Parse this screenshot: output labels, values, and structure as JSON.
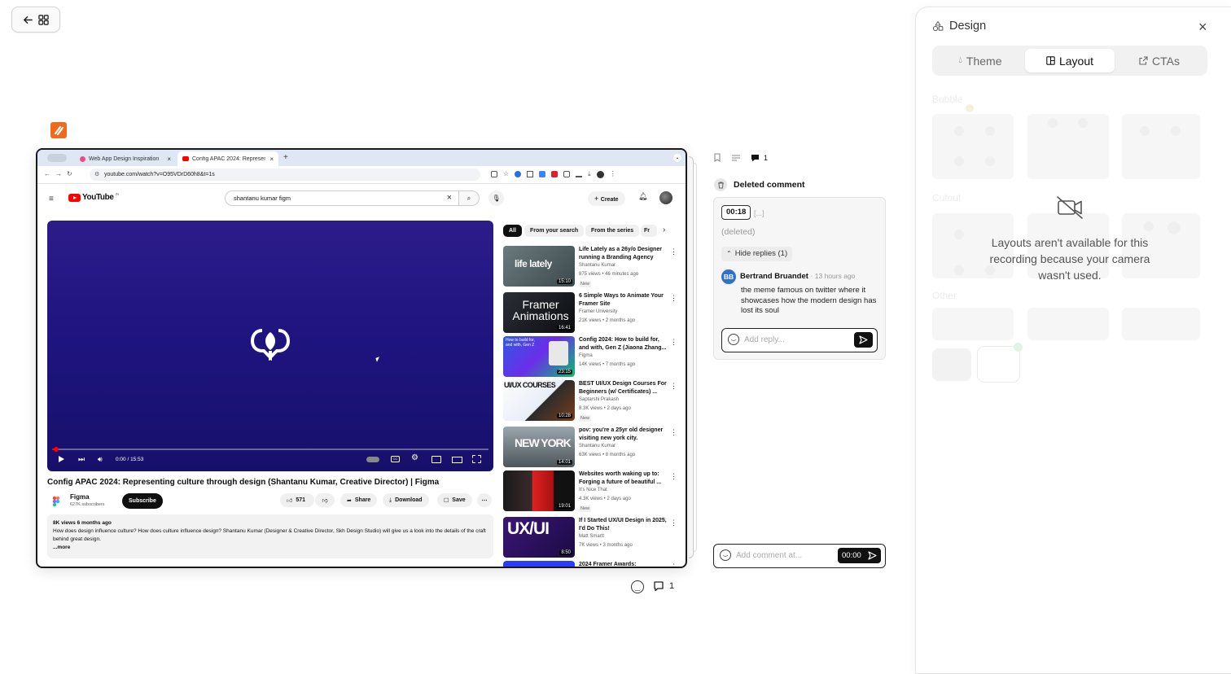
{
  "browser": {
    "tabs": [
      {
        "label": "Web App Design Inspiration"
      },
      {
        "label": "Config APAC 2024: Represen"
      }
    ],
    "url": "youtube.com/watch?v=O95VDrD60h8&t=1s"
  },
  "youtube": {
    "logo_text": "YouTube",
    "region": "IN",
    "search_value": "shantanu kumar figm",
    "create_label": "Create",
    "chips": [
      "All",
      "From your search",
      "From the series",
      "Fr"
    ],
    "player_time": "0:00 / 15:53",
    "video_title": "Config APAC 2024: Representing culture through design (Shantanu Kumar, Creative Director) | Figma",
    "channel_name": "Figma",
    "channel_subs": "627K subscribers",
    "subscribe_label": "Subscribe",
    "likes": "571",
    "share_label": "Share",
    "download_label": "Download",
    "save_label": "Save",
    "desc_stats": "8K views  6 months ago",
    "desc_text": "How does design influence culture? How does culture influence design? Shantanu Kumar (Designer & Creative Director, Skh Design Studio) will give us a look into the details of the craft behind great design.",
    "desc_more": "...more",
    "recs": [
      {
        "title": "Life Lately as a 26y/o Designer running a Branding Agency",
        "channel": "Shantanu Kumar",
        "meta": "875 views • 46 minutes ago",
        "new": "New",
        "duration": "15:10",
        "thumb_text": "life lately"
      },
      {
        "title": "6 Simple Ways to Animate Your Framer Site",
        "channel": "Framer University",
        "meta": "21K views • 2 months ago",
        "new": "",
        "duration": "16:41",
        "thumb_text": "Framer Animations"
      },
      {
        "title": "Config 2024: How to build for, and with, Gen Z (Jiaona Zhang...",
        "channel": "Figma",
        "meta": "14K views • 7 months ago",
        "new": "",
        "duration": "23:15",
        "thumb_text": "How to build for, and with, Gen Z"
      },
      {
        "title": "BEST UI/UX Design Courses For Beginners (w/ Certificates) ...",
        "channel": "Saptarshi Prakash",
        "meta": "8.3K views • 2 days ago",
        "new": "New",
        "duration": "10:28",
        "thumb_text": "UI/UX COURSES"
      },
      {
        "title": "pov: you're a 25yr old designer visiting new york city.",
        "channel": "Shantanu Kumar",
        "meta": "63K views • 8 months ago",
        "new": "",
        "duration": "14:01",
        "thumb_text": "NEW YORK"
      },
      {
        "title": "Websites worth waking up to: Forging a future of beautiful ...",
        "channel": "It's Nice That",
        "meta": "4.3K views • 2 days ago",
        "new": "New",
        "duration": "19:01",
        "thumb_text": ""
      },
      {
        "title": "If I Started UX/UI Design in 2025, I'd Do This!",
        "channel": "Matt Smartt",
        "meta": "7K views • 3 months ago",
        "new": "",
        "duration": "8:50",
        "thumb_text": "UX/UI"
      },
      {
        "title": "2024 Framer Awards:",
        "channel": "",
        "meta": "",
        "new": "",
        "duration": "",
        "thumb_text": ""
      }
    ]
  },
  "below_video": {
    "comment_count": "1"
  },
  "comments": {
    "toolbar_count": "1",
    "deleted_header": "Deleted comment",
    "timestamp": "00:18",
    "ellipsis": "[...]",
    "deleted_text": "(deleted)",
    "hide_replies": "Hide replies (1)",
    "reply": {
      "initials": "BB",
      "author": "Bertrand Bruandet",
      "time": "· 13 hours ago",
      "text": "the meme famous on twitter where it showcases how the modern design has lost its soul"
    },
    "reply_placeholder": "Add reply...",
    "add_comment_placeholder": "Add comment at...",
    "add_comment_time": "00:00"
  },
  "design_panel": {
    "title": "Design",
    "tabs": [
      "Theme",
      "Layout",
      "CTAs"
    ],
    "active_tab": "Layout",
    "sections": [
      "Bubble",
      "Cutout",
      "Other"
    ],
    "message": "Layouts aren't available for this recording because your camera wasn't used."
  }
}
